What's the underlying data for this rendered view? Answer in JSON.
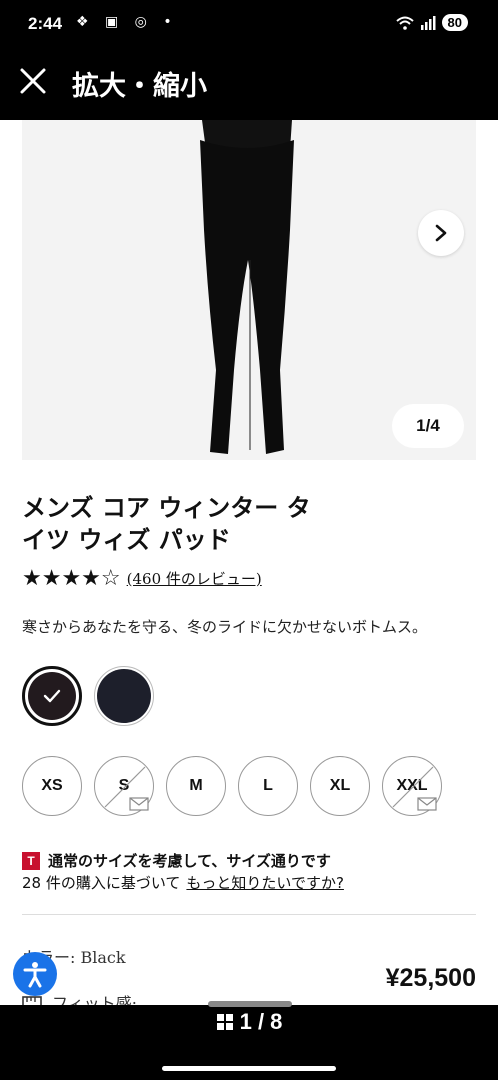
{
  "status": {
    "time": "2:44",
    "left_icons": "❖ ▣ ◎ •",
    "battery": "80"
  },
  "topbar": {
    "title": "拡大・縮小"
  },
  "gallery": {
    "counter": "1/4"
  },
  "product": {
    "title": "メンズ コア ウィンター タイツ ウィズ パッド",
    "rating": 4.5,
    "stars": "★★★★☆",
    "reviews": "(460 件のレビュー)",
    "description": "寒さからあなたを守る、冬のライドに欠かせないボトムス。",
    "swatch_colors": [
      "#221a1e",
      "#1d1f2b"
    ],
    "sizes": [
      {
        "label": "XS",
        "available": true
      },
      {
        "label": "S",
        "available": false
      },
      {
        "label": "M",
        "available": true
      },
      {
        "label": "L",
        "available": true
      },
      {
        "label": "XL",
        "available": true
      },
      {
        "label": "XXL",
        "available": false
      }
    ],
    "fit_badge": "T",
    "fit_summary": "通常のサイズを考慮して、サイズ通りです",
    "fit_basis": "28 件の購入に基づいて",
    "fit_link": "もっと知りたいですか?",
    "color_label": "カラー: Black",
    "fit_label": "フィット感:",
    "price": "¥25,500"
  },
  "bottombar": {
    "page": "1 / 8"
  }
}
